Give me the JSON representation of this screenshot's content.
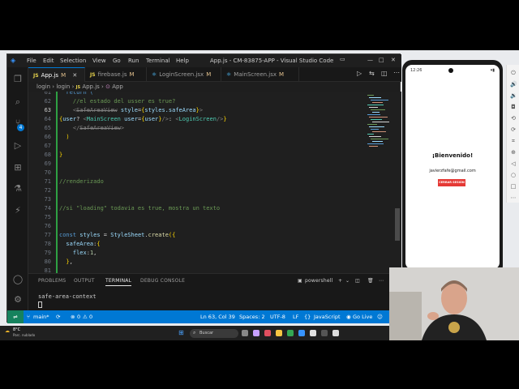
{
  "window": {
    "title": "App.js - CM-83875-APP - Visual Studio Code",
    "menu": [
      "File",
      "Edit",
      "Selection",
      "View",
      "Go",
      "Run",
      "Terminal",
      "Help"
    ]
  },
  "tabs": [
    {
      "type": "JS",
      "label": "App.js",
      "status": "M"
    },
    {
      "type": "JS",
      "label": "firebase.js",
      "status": "M"
    },
    {
      "type": "JSX",
      "label": "LoginScreen.jsx",
      "status": "M"
    },
    {
      "type": "JSX",
      "label": "MainScreen.jsx",
      "status": "M"
    }
  ],
  "breadcrumb": [
    "login",
    "login",
    "App.js",
    "App"
  ],
  "activity_badge": "4",
  "code_lines": [
    {
      "num": "61",
      "text": "return ("
    },
    {
      "num": "62",
      "text": "//el estado del usser es true?"
    },
    {
      "num": "63",
      "text": "<SafeAreaView style={styles.safeArea}>"
    },
    {
      "num": "64",
      "text": "{user? <MainScreen user={user}/>: <LoginScreen/>}"
    },
    {
      "num": "65",
      "text": "</SafeAreaView>"
    },
    {
      "num": "66",
      "text": ")"
    },
    {
      "num": "67",
      "text": ""
    },
    {
      "num": "68",
      "text": "}"
    },
    {
      "num": "69",
      "text": ""
    },
    {
      "num": "70",
      "text": ""
    },
    {
      "num": "71",
      "text": "//renderizado"
    },
    {
      "num": "72",
      "text": ""
    },
    {
      "num": "73",
      "text": ""
    },
    {
      "num": "74",
      "text": "//si \"loading\" todavia es true, mostra un texto"
    },
    {
      "num": "75",
      "text": ""
    },
    {
      "num": "76",
      "text": ""
    },
    {
      "num": "77",
      "text": "const styles = StyleSheet.create({"
    },
    {
      "num": "78",
      "text": "safeArea:{"
    },
    {
      "num": "79",
      "text": "flex:1,"
    },
    {
      "num": "80",
      "text": "},"
    },
    {
      "num": "81",
      "text": ""
    }
  ],
  "panel": {
    "tabs": [
      "PROBLEMS",
      "OUTPUT",
      "TERMINAL",
      "DEBUG CONSOLE"
    ],
    "active_tab": "TERMINAL",
    "shell": "powershell",
    "terminal_line": "safe-area-context"
  },
  "statusbar": {
    "branch": "main*",
    "errors": "0",
    "warnings": "0",
    "position": "Ln 63, Col 39",
    "spaces": "Spaces: 2",
    "encoding": "UTF-8",
    "eol": "LF",
    "language": "JavaScript",
    "golive": "Go Live"
  },
  "phone": {
    "time": "12:26",
    "welcome": "¡Bienvenido!",
    "email": "javierzfafe@gmail.com",
    "logout_label": "CERRAR SESIÓN"
  },
  "taskbar": {
    "weather_temp": "8°C",
    "weather_desc": "Parc. nublado",
    "search": "Buscar"
  },
  "colors": {
    "accent": "#0078d4",
    "logout_button": "#e53935",
    "modified": "#e2c08d"
  }
}
